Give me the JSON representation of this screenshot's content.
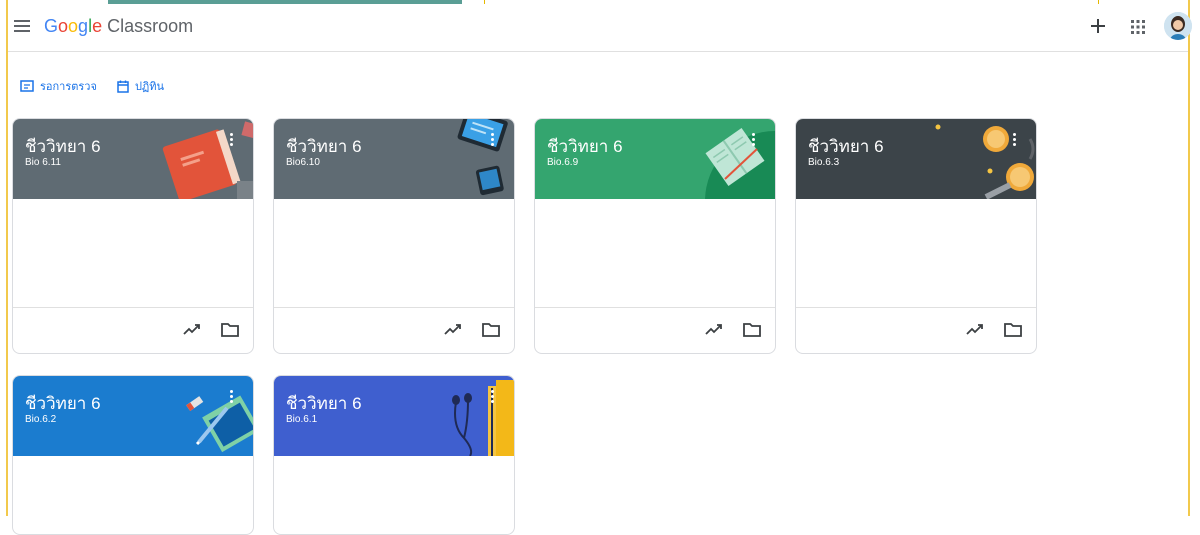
{
  "app": {
    "logo_google": "Google",
    "logo_product": "Classroom"
  },
  "toolbar": {
    "to_review": "รอการตรวจ",
    "calendar": "ปฏิทิน"
  },
  "classes": [
    {
      "title": "ชีววิทยา 6",
      "section": "Bio 6.11",
      "color": "#5f6b73"
    },
    {
      "title": "ชีววิทยา 6",
      "section": "Bio6.10",
      "color": "#5f6b73"
    },
    {
      "title": "ชีววิทยา 6",
      "section": "Bio.6.9",
      "color": "#34a56f"
    },
    {
      "title": "ชีววิทยา 6",
      "section": "Bio.6.3",
      "color": "#3c4449"
    },
    {
      "title": "ชีววิทยา 6",
      "section": "Bio.6.2",
      "color": "#1b7ccf"
    },
    {
      "title": "ชีววิทยา 6",
      "section": "Bio.6.1",
      "color": "#3f5fcf"
    }
  ],
  "icons": {
    "menu": "hamburger-menu-icon",
    "add": "plus-icon",
    "apps": "apps-grid-icon",
    "account": "avatar",
    "to_review": "assignment-icon",
    "calendar": "calendar-icon",
    "more": "more-vertical-icon",
    "gradebook": "trending-up-icon",
    "drive": "folder-icon"
  }
}
